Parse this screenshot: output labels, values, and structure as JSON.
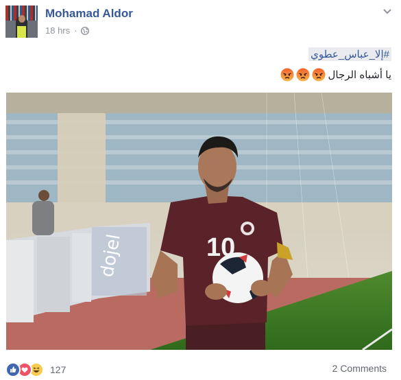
{
  "post": {
    "author": "Mohamad Aldor",
    "time": "18 hrs",
    "separator": "·",
    "privacy_icon": "globe-icon",
    "menu_icon": "chevron-down-icon",
    "hashtag": "#إلا_عباس_عطوي",
    "text": "يا أشباه الرجال",
    "emoji": [
      "angry-emoji",
      "angry-emoji",
      "angry-emoji"
    ],
    "photo": {
      "jersey_number": "10"
    },
    "reactions": {
      "icons": [
        "like-icon",
        "love-icon",
        "haha-icon"
      ],
      "count": "127"
    },
    "comments_label": "2 Comments"
  },
  "colors": {
    "link_blue": "#365899",
    "meta_gray": "#90949c",
    "hashtag_bg": "#e9ebee",
    "like_blue": "#4267b2",
    "love_red": "#f25268",
    "haha_yellow": "#f7cb4f",
    "angry_orange": "#e9710f"
  }
}
